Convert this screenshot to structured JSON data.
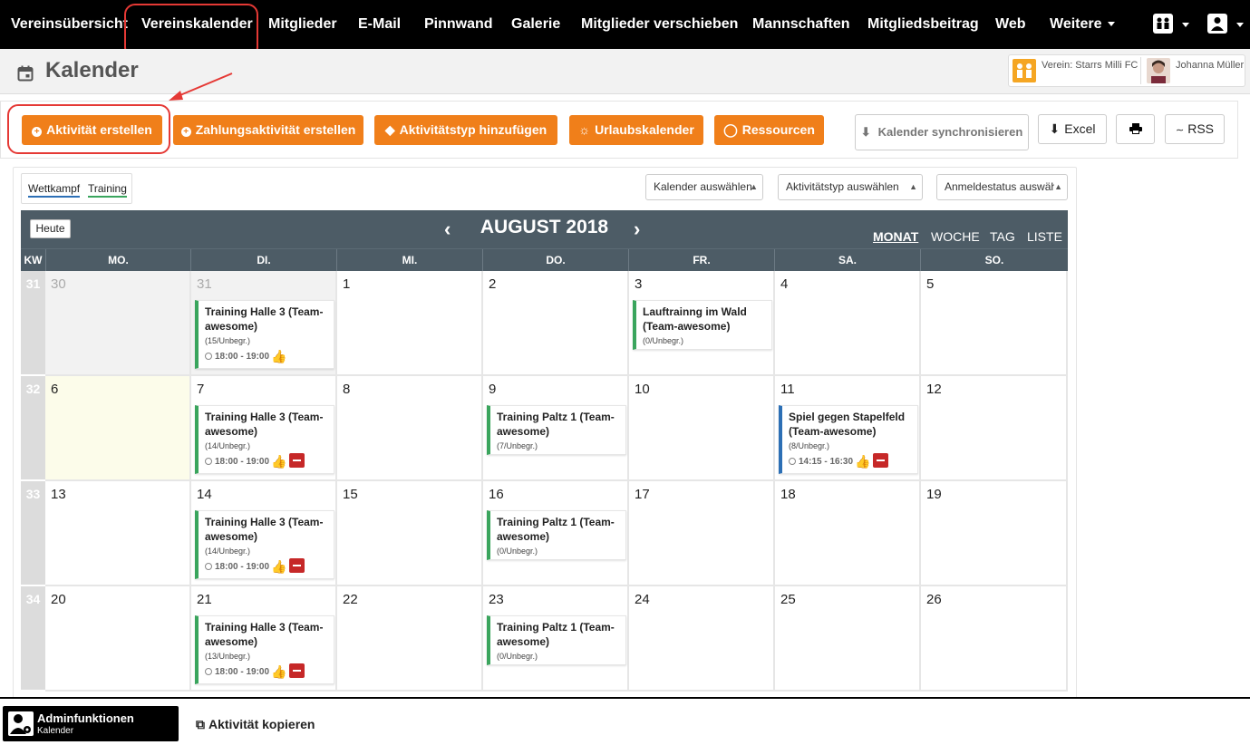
{
  "nav": {
    "items": [
      "Vereinsübersicht",
      "Vereinskalender",
      "Mitglieder",
      "E-Mail",
      "Pinnwand",
      "Galerie",
      "Mitglieder verschieben",
      "Mannschaften",
      "Mitgliedsbeitrag",
      "Web",
      "Weitere"
    ],
    "active": "Vereinskalender"
  },
  "header": {
    "title": "Kalender",
    "club": "Verein: Starrs Milli FC",
    "user": "Johanna Müller"
  },
  "toolbar": {
    "create": "Aktivität erstellen",
    "payment": "Zahlungsaktivität erstellen",
    "type": "Aktivitätstyp hinzufügen",
    "vacation": "Urlaubskalender",
    "resources": "Ressourcen",
    "sync": "Kalender synchronisieren",
    "excel": "Excel",
    "rss": "RSS"
  },
  "legend": {
    "comp": "Wettkampf",
    "training": "Training"
  },
  "filters": [
    "Kalender auswählen",
    "Aktivitätstyp auswählen",
    "Anmeldestatus auswäh"
  ],
  "calendar": {
    "today_label": "Heute",
    "month": "AUGUST 2018",
    "views": [
      "MONAT",
      "WOCHE",
      "TAG",
      "LISTE"
    ],
    "active_view": "MONAT",
    "kw_label": "KW",
    "days": [
      "MO.",
      "DI.",
      "MI.",
      "DO.",
      "FR.",
      "SA.",
      "SO."
    ],
    "weeks": [
      {
        "kw": "31",
        "dates": [
          "30",
          "31",
          "1",
          "2",
          "3",
          "4",
          "5"
        ]
      },
      {
        "kw": "32",
        "dates": [
          "6",
          "7",
          "8",
          "9",
          "10",
          "11",
          "12"
        ]
      },
      {
        "kw": "33",
        "dates": [
          "13",
          "14",
          "15",
          "16",
          "17",
          "18",
          "19"
        ]
      },
      {
        "kw": "34",
        "dates": [
          "20",
          "21",
          "22",
          "23",
          "24",
          "25",
          "26"
        ]
      }
    ],
    "events": [
      {
        "title": "Training Halle 3 (Team-awesome)",
        "count": "(15/Unbegr.)",
        "time": "18:00 - 19:00"
      },
      {
        "title": "Lauftrainng im Wald (Team-awesome)",
        "count": "(0/Unbegr.)",
        "time": ""
      },
      {
        "title": "Training Halle 3 (Team-awesome)",
        "count": "(14/Unbegr.)",
        "time": "18:00 - 19:00"
      },
      {
        "title": "Training Paltz 1 (Team-awesome)",
        "count": "(7/Unbegr.)",
        "time": ""
      },
      {
        "title": "Spiel gegen Stapelfeld (Team-awesome)",
        "count": "(8/Unbegr.)",
        "time": "14:15 - 16:30"
      },
      {
        "title": "Training Halle 3 (Team-awesome)",
        "count": "(14/Unbegr.)",
        "time": "18:00 - 19:00"
      },
      {
        "title": "Training Paltz 1 (Team-awesome)",
        "count": "(0/Unbegr.)",
        "time": ""
      },
      {
        "title": "Training Halle 3 (Team-awesome)",
        "count": "(13/Unbegr.)",
        "time": "18:00 - 19:00"
      },
      {
        "title": "Training Paltz 1 (Team-awesome)",
        "count": "(0/Unbegr.)",
        "time": ""
      }
    ]
  },
  "bottom": {
    "admin_title": "Adminfunktionen",
    "admin_sub": "Kalender",
    "copy": "Aktivität kopieren"
  },
  "colors": {
    "accent": "#f07f1a",
    "competition": "#2c6fb5",
    "training": "#3aa55d",
    "decline": "#c62828"
  }
}
